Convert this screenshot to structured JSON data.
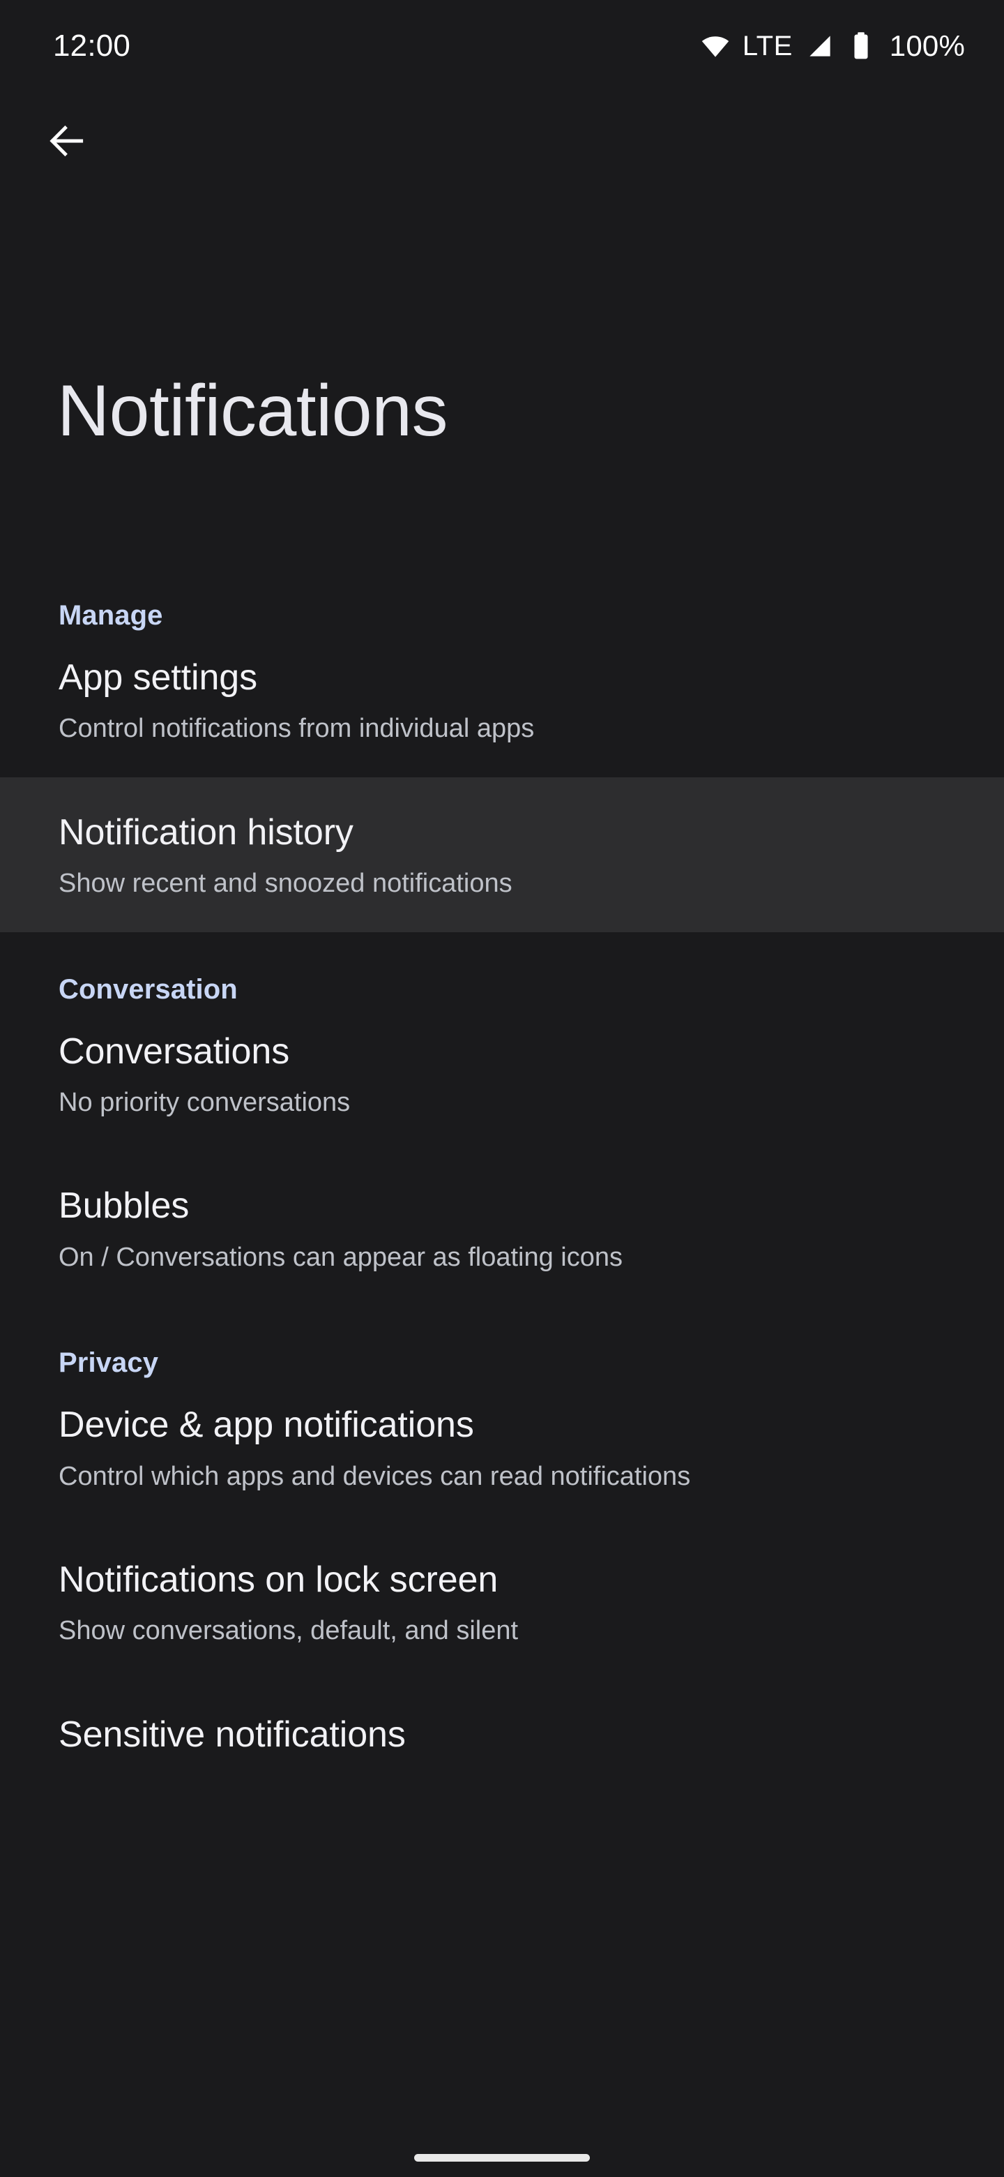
{
  "status_bar": {
    "time": "12:00",
    "network_label": "LTE",
    "battery_percent": "100%",
    "icons": [
      "wifi-icon",
      "signal-icon",
      "battery-icon"
    ]
  },
  "toolbar": {
    "back_label": "Back",
    "back_icon": "arrow-back-icon"
  },
  "header": {
    "title": "Notifications"
  },
  "colors": {
    "background": "#1a1a1c",
    "highlight_row": "#2d2d2f",
    "section_accent": "#c8d6f5",
    "title_text": "#e8e8ee",
    "row_title_text": "#f2f2f6",
    "row_summary_text": "#bfc2c9",
    "status_text": "#ffffff",
    "gesture_bar": "#e8e8e8"
  },
  "sections": [
    {
      "header": "Manage",
      "items": [
        {
          "title": "App settings",
          "summary": "Control notifications from individual apps",
          "highlighted": false
        },
        {
          "title": "Notification history",
          "summary": "Show recent and snoozed notifications",
          "highlighted": true
        }
      ]
    },
    {
      "header": "Conversation",
      "items": [
        {
          "title": "Conversations",
          "summary": "No priority conversations",
          "highlighted": false
        },
        {
          "title": "Bubbles",
          "summary": "On / Conversations can appear as floating icons",
          "highlighted": false
        }
      ]
    },
    {
      "header": "Privacy",
      "items": [
        {
          "title": "Device & app notifications",
          "summary": "Control which apps and devices can read notifications",
          "highlighted": false
        },
        {
          "title": "Notifications on lock screen",
          "summary": "Show conversations, default, and silent",
          "highlighted": false
        },
        {
          "title": "Sensitive notifications",
          "summary": "",
          "highlighted": false
        }
      ]
    }
  ]
}
